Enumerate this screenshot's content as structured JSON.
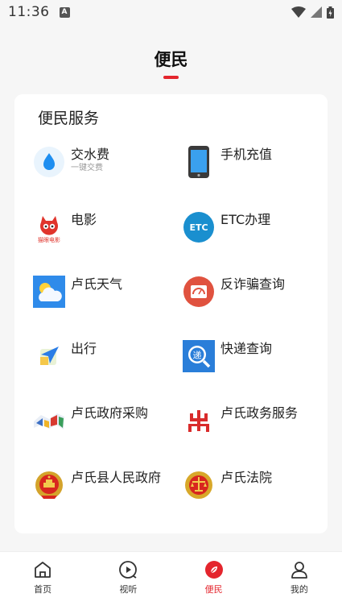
{
  "status_bar": {
    "time": "11:36",
    "badge": "A"
  },
  "header": {
    "title": "便民"
  },
  "card": {
    "title": "便民服务",
    "services": [
      {
        "name": "交水费",
        "sub": "一键交费",
        "icon": "water-drop-icon"
      },
      {
        "name": "手机充值",
        "icon": "phone-icon"
      },
      {
        "name": "电影",
        "logo_text": "猫眼电影",
        "icon": "maoyan-movie-icon"
      },
      {
        "name": "ETC办理",
        "logo_text": "ETC",
        "icon": "etc-icon"
      },
      {
        "name": "卢氏天气",
        "icon": "weather-icon"
      },
      {
        "name": "反诈骗查询",
        "icon": "anti-fraud-icon"
      },
      {
        "name": "出行",
        "icon": "travel-icon"
      },
      {
        "name": "快递查询",
        "logo_text": "递",
        "icon": "express-icon"
      },
      {
        "name": "卢氏政府采购",
        "icon": "procurement-icon"
      },
      {
        "name": "卢氏政务服务",
        "icon": "gov-service-icon"
      },
      {
        "name": "卢氏县人民政府",
        "icon": "national-emblem-icon"
      },
      {
        "name": "卢氏法院",
        "icon": "court-emblem-icon"
      }
    ]
  },
  "bottom_nav": [
    {
      "label": "首页",
      "icon": "home-icon",
      "active": false
    },
    {
      "label": "视听",
      "icon": "play-icon",
      "active": false
    },
    {
      "label": "便民",
      "icon": "convenience-icon",
      "active": true
    },
    {
      "label": "我的",
      "icon": "user-icon",
      "active": false
    }
  ],
  "colors": {
    "accent": "#e4252d",
    "background": "#f6f6f6",
    "card": "#ffffff"
  }
}
